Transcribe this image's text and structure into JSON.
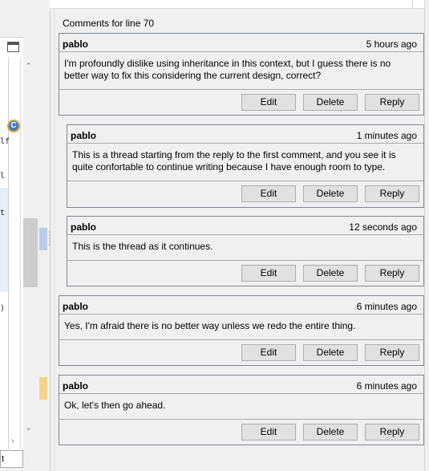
{
  "editor": {
    "code_fragments": [
      "lf",
      "l",
      "t",
      ")"
    ],
    "annotation_marker": "C",
    "bottom_input_value": "t"
  },
  "comments_panel": {
    "title": "Comments for line 70",
    "buttons": {
      "edit": "Edit",
      "delete": "Delete",
      "reply": "Reply"
    },
    "comments": [
      {
        "author": "pablo",
        "time": "5 hours ago",
        "text": "I'm profoundly dislike using inheritance in this context, but I guess there is no better way to fix this considering the current design, correct?",
        "depth": 0
      },
      {
        "author": "pablo",
        "time": "1 minutes ago",
        "text": "This is a thread starting from the reply to the first comment, and you see it is quite confortable to continue writing because I have enough room to type.",
        "depth": 1
      },
      {
        "author": "pablo",
        "time": "12 seconds ago",
        "text": "This is the thread as it continues.",
        "depth": 1
      },
      {
        "author": "pablo",
        "time": "6 minutes ago",
        "text": "Yes, I'm afraid there is no better way unless we redo the entire thing.",
        "depth": 0
      },
      {
        "author": "pablo",
        "time": "6 minutes ago",
        "text": "Ok, let's then go ahead.",
        "depth": 0
      }
    ]
  }
}
